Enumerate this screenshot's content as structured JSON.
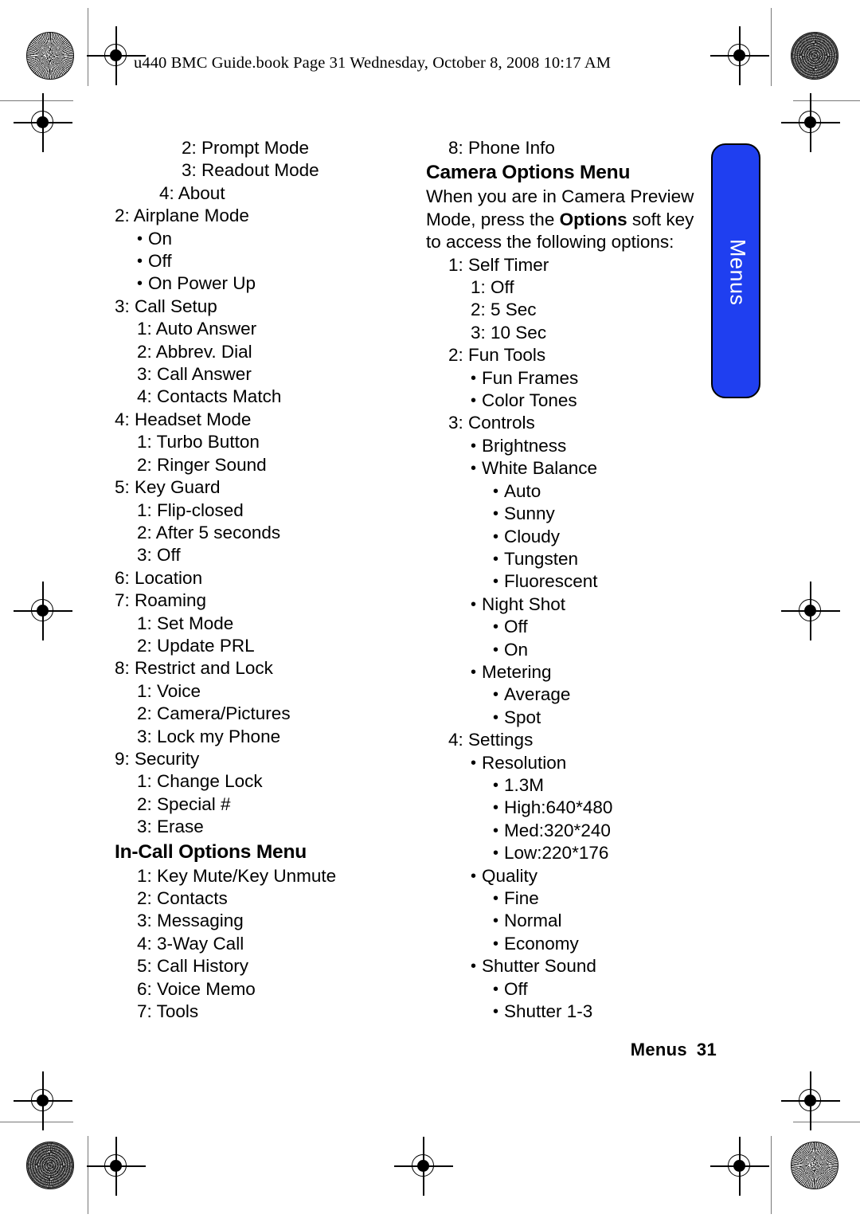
{
  "page_header": "u440 BMC Guide.book  Page 31  Wednesday, October 8, 2008  10:17 AM",
  "side_tab": {
    "label": "Menus",
    "color": "#1f3ff0",
    "text_color": "#ffffff"
  },
  "footer": {
    "section": "Menus",
    "page_number": "31"
  },
  "left_column": {
    "lines": [
      {
        "text": "2: Prompt Mode",
        "level": 3,
        "type": "num"
      },
      {
        "text": "3: Readout Mode",
        "level": 3,
        "type": "num"
      },
      {
        "text": "4: About",
        "level": 2,
        "type": "num"
      },
      {
        "text": "2: Airplane Mode",
        "level": 0,
        "type": "num"
      },
      {
        "text": "On",
        "level": 1,
        "type": "bullet"
      },
      {
        "text": "Off",
        "level": 1,
        "type": "bullet"
      },
      {
        "text": "On Power Up",
        "level": 1,
        "type": "bullet"
      },
      {
        "text": "3: Call Setup",
        "level": 0,
        "type": "num"
      },
      {
        "text": "1: Auto Answer",
        "level": 1,
        "type": "num"
      },
      {
        "text": "2: Abbrev. Dial",
        "level": 1,
        "type": "num"
      },
      {
        "text": "3: Call Answer",
        "level": 1,
        "type": "num"
      },
      {
        "text": "4: Contacts Match",
        "level": 1,
        "type": "num"
      },
      {
        "text": "4: Headset Mode",
        "level": 0,
        "type": "num"
      },
      {
        "text": "1: Turbo Button",
        "level": 1,
        "type": "num"
      },
      {
        "text": "2: Ringer Sound",
        "level": 1,
        "type": "num"
      },
      {
        "text": "5: Key Guard",
        "level": 0,
        "type": "num"
      },
      {
        "text": "1: Flip-closed",
        "level": 1,
        "type": "num"
      },
      {
        "text": "2: After 5 seconds",
        "level": 1,
        "type": "num"
      },
      {
        "text": "3: Off",
        "level": 1,
        "type": "num"
      },
      {
        "text": "6: Location",
        "level": 0,
        "type": "num"
      },
      {
        "text": "7: Roaming",
        "level": 0,
        "type": "num"
      },
      {
        "text": "1: Set Mode",
        "level": 1,
        "type": "num"
      },
      {
        "text": "2: Update PRL",
        "level": 1,
        "type": "num"
      },
      {
        "text": "8: Restrict and Lock",
        "level": 0,
        "type": "num"
      },
      {
        "text": "1: Voice",
        "level": 1,
        "type": "num"
      },
      {
        "text": "2: Camera/Pictures",
        "level": 1,
        "type": "num"
      },
      {
        "text": "3: Lock my Phone",
        "level": 1,
        "type": "num"
      },
      {
        "text": "9: Security",
        "level": 0,
        "type": "num"
      },
      {
        "text": "1: Change Lock",
        "level": 1,
        "type": "num"
      },
      {
        "text": "2: Special #",
        "level": 1,
        "type": "num"
      },
      {
        "text": "3: Erase",
        "level": 1,
        "type": "num"
      }
    ],
    "heading": "In-Call Options Menu",
    "after_heading_lines": [
      {
        "text": "1: Key Mute/Key Unmute",
        "level": 1,
        "type": "num"
      },
      {
        "text": "2: Contacts",
        "level": 1,
        "type": "num"
      },
      {
        "text": "3: Messaging",
        "level": 1,
        "type": "num"
      },
      {
        "text": "4: 3-Way Call",
        "level": 1,
        "type": "num"
      },
      {
        "text": "5: Call History",
        "level": 1,
        "type": "num"
      },
      {
        "text": "6: Voice Memo",
        "level": 1,
        "type": "num"
      },
      {
        "text": "7: Tools",
        "level": 1,
        "type": "num"
      }
    ]
  },
  "right_column": {
    "top_line": {
      "text": "8: Phone Info",
      "level": 1,
      "type": "num"
    },
    "heading": "Camera Options Menu",
    "paragraph": {
      "part1": "When you are in Camera Preview Mode, press the ",
      "bold": "Options",
      "part2": " soft key to access the following options:"
    },
    "lines": [
      {
        "text": "1: Self Timer",
        "level": 1,
        "type": "num"
      },
      {
        "text": "1: Off",
        "level": 2,
        "type": "num"
      },
      {
        "text": "2: 5 Sec",
        "level": 2,
        "type": "num"
      },
      {
        "text": "3: 10 Sec",
        "level": 2,
        "type": "num"
      },
      {
        "text": "2: Fun Tools",
        "level": 1,
        "type": "num"
      },
      {
        "text": "Fun Frames",
        "level": 2,
        "type": "bullet"
      },
      {
        "text": "Color Tones",
        "level": 2,
        "type": "bullet"
      },
      {
        "text": "3: Controls",
        "level": 1,
        "type": "num"
      },
      {
        "text": "Brightness",
        "level": 2,
        "type": "bullet"
      },
      {
        "text": "White Balance",
        "level": 2,
        "type": "bullet"
      },
      {
        "text": "Auto",
        "level": 3,
        "type": "bullet"
      },
      {
        "text": "Sunny",
        "level": 3,
        "type": "bullet"
      },
      {
        "text": "Cloudy",
        "level": 3,
        "type": "bullet"
      },
      {
        "text": "Tungsten",
        "level": 3,
        "type": "bullet"
      },
      {
        "text": "Fluorescent",
        "level": 3,
        "type": "bullet"
      },
      {
        "text": "Night Shot",
        "level": 2,
        "type": "bullet"
      },
      {
        "text": "Off",
        "level": 3,
        "type": "bullet"
      },
      {
        "text": "On",
        "level": 3,
        "type": "bullet"
      },
      {
        "text": "Metering",
        "level": 2,
        "type": "bullet"
      },
      {
        "text": "Average",
        "level": 3,
        "type": "bullet"
      },
      {
        "text": "Spot",
        "level": 3,
        "type": "bullet"
      },
      {
        "text": "4: Settings",
        "level": 1,
        "type": "num"
      },
      {
        "text": "Resolution",
        "level": 2,
        "type": "bullet"
      },
      {
        "text": "1.3M",
        "level": 3,
        "type": "bullet"
      },
      {
        "text": "High:640*480",
        "level": 3,
        "type": "bullet"
      },
      {
        "text": "Med:320*240",
        "level": 3,
        "type": "bullet"
      },
      {
        "text": "Low:220*176",
        "level": 3,
        "type": "bullet"
      },
      {
        "text": "Quality",
        "level": 2,
        "type": "bullet"
      },
      {
        "text": "Fine",
        "level": 3,
        "type": "bullet"
      },
      {
        "text": "Normal",
        "level": 3,
        "type": "bullet"
      },
      {
        "text": "Economy",
        "level": 3,
        "type": "bullet"
      },
      {
        "text": "Shutter Sound",
        "level": 2,
        "type": "bullet"
      },
      {
        "text": "Off",
        "level": 3,
        "type": "bullet"
      },
      {
        "text": "Shutter 1-3",
        "level": 3,
        "type": "bullet"
      }
    ]
  }
}
